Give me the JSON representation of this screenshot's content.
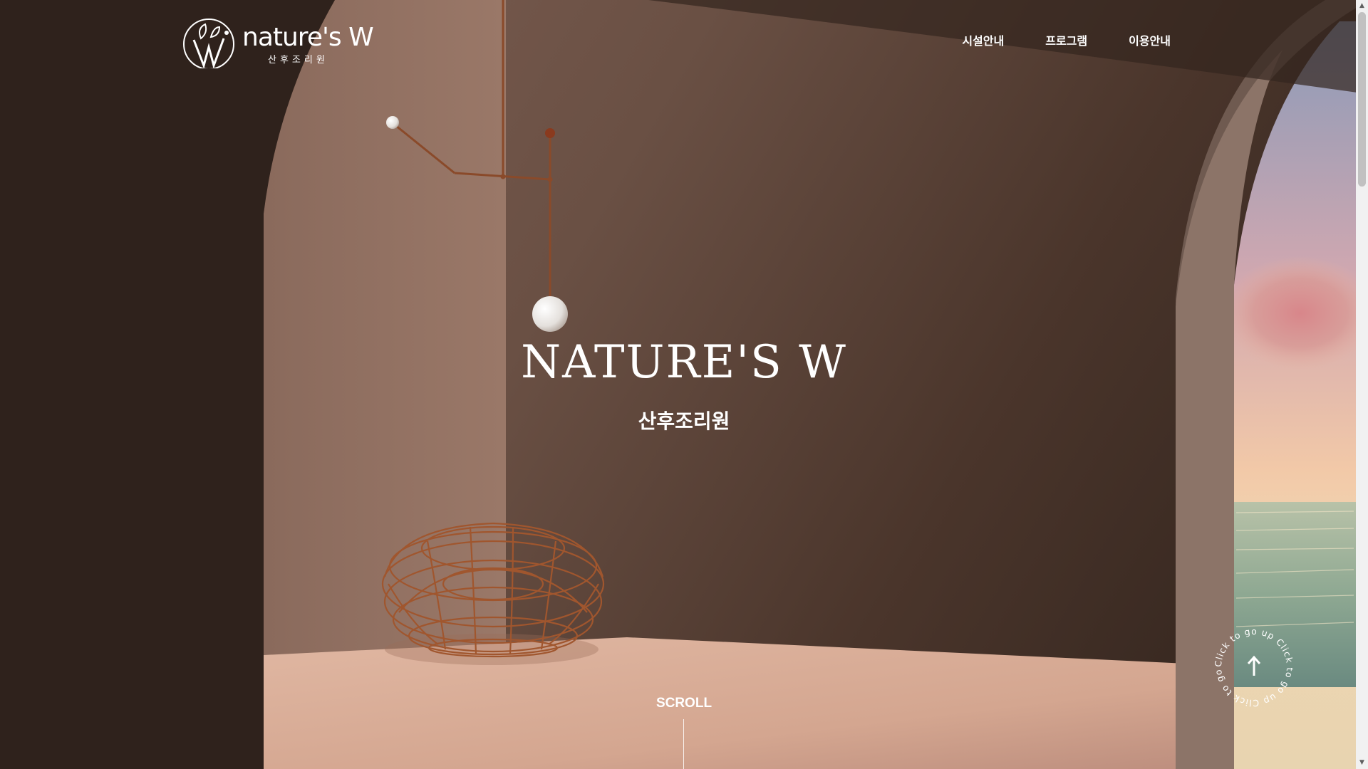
{
  "brand": {
    "logo_text": "nature's W",
    "logo_subtext": "산후조리원"
  },
  "nav": {
    "items": [
      {
        "label": "시설안내"
      },
      {
        "label": "프로그램"
      },
      {
        "label": "이용안내"
      }
    ]
  },
  "hero": {
    "title": "NATURE'S W",
    "subtitle": "산후조리원"
  },
  "scroll_indicator": {
    "label": "SCROLL"
  },
  "go_top": {
    "ring_text": "Click to go up  Click to go up  Click to go up",
    "icon": "arrow-up-icon"
  },
  "scrollbar": {
    "up_icon": "▲",
    "down_icon": "▼"
  },
  "colors": {
    "wall_dark": "#2f221c",
    "wall_mid": "#6f5548",
    "floor": "#d8ab96",
    "mobile_rod": "#8a4a2a",
    "chair_wire": "#a0562e",
    "text": "#ffffff"
  }
}
